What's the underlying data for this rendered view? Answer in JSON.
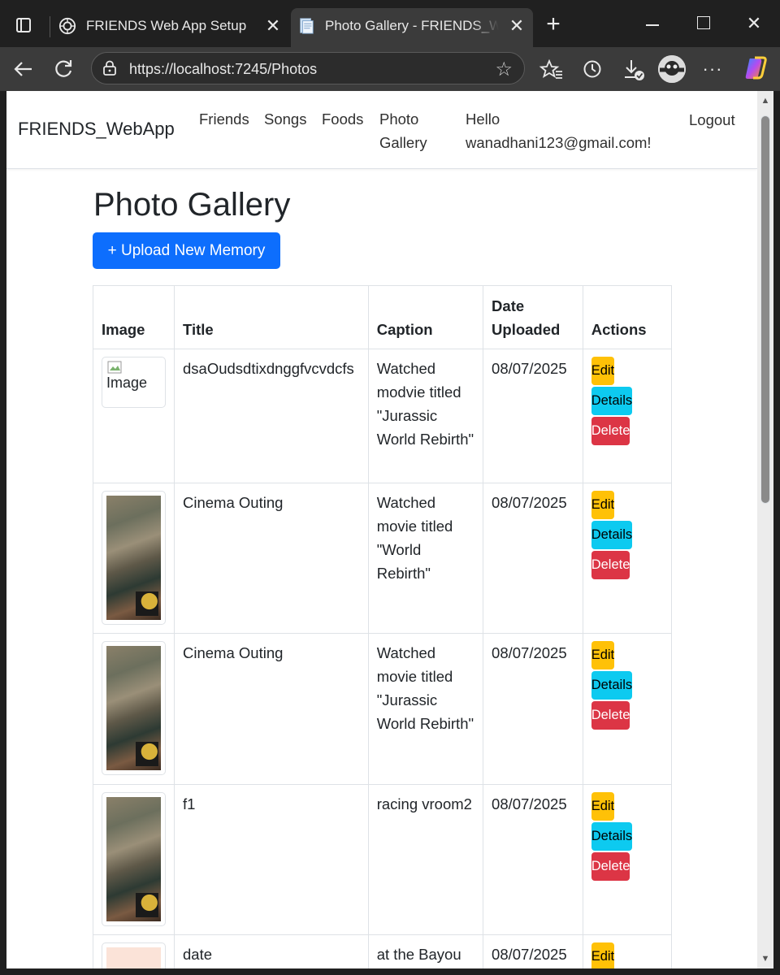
{
  "browser": {
    "tabs": [
      {
        "title": "FRIENDS Web App Setup",
        "active": false
      },
      {
        "title": "Photo Gallery - FRIENDS_WebApp",
        "active": true
      }
    ],
    "url": "https://localhost:7245/Photos"
  },
  "navbar": {
    "brand": "FRIENDS_WebApp",
    "links": [
      "Friends",
      "Songs",
      "Foods"
    ],
    "photo_gallery_line1": "Photo",
    "photo_gallery_line2": "Gallery",
    "hello_line1": "Hello",
    "hello_line2": "wanadhani123@gmail.com!",
    "logout": "Logout"
  },
  "page": {
    "title": "Photo Gallery",
    "upload_button": "+ Upload New Memory"
  },
  "table": {
    "headers": {
      "image": "Image",
      "title": "Title",
      "caption": "Caption",
      "date_line1": "Date",
      "date_line2": "Uploaded",
      "actions": "Actions"
    },
    "rows": [
      {
        "image_alt": "Image",
        "title": "dsaOudsdtixdnggfvcvdcfs",
        "caption": "Watched modvie titled \"Jurassic World Rebirth\"",
        "date": "08/07/2025"
      },
      {
        "image_alt": "",
        "title": "Cinema Outing",
        "caption": "Watched movie titled \"World Rebirth\"",
        "date": "08/07/2025"
      },
      {
        "image_alt": "",
        "title": "Cinema Outing",
        "caption": "Watched movie titled \"Jurassic World Rebirth\"",
        "date": "08/07/2025"
      },
      {
        "image_alt": "",
        "title": "f1",
        "caption": "racing vroom2",
        "date": "08/07/2025"
      },
      {
        "image_alt": "",
        "title": "date",
        "caption": "at the Bayou",
        "date": "08/07/2025"
      }
    ],
    "actions": {
      "edit": "Edit",
      "details": "Details",
      "delete": "Delete"
    }
  },
  "colors": {
    "primary": "#0d6efd",
    "warning": "#ffc107",
    "info": "#0dcaf0",
    "danger": "#dc3545",
    "browser_dark": "#202020"
  }
}
